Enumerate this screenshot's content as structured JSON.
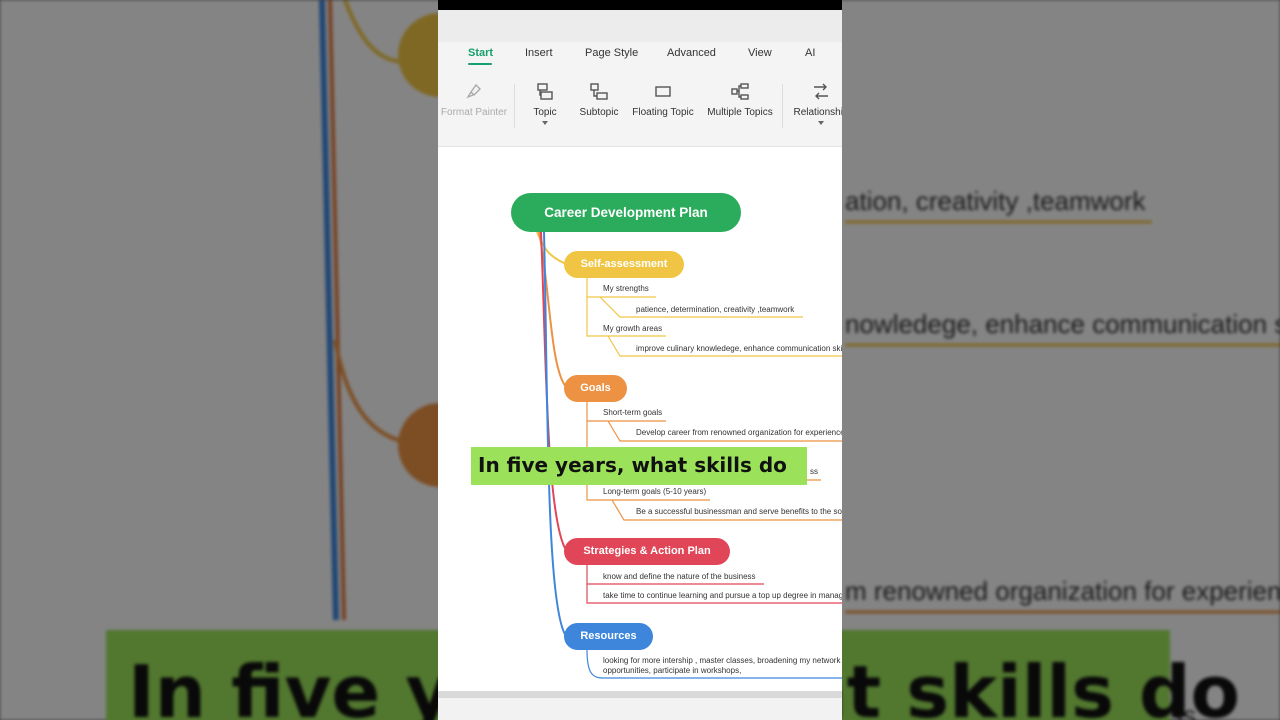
{
  "menu": {
    "tabs": [
      "Start",
      "Insert",
      "Page Style",
      "Advanced",
      "View",
      "AI"
    ],
    "active_tab": "Start"
  },
  "toolbar": {
    "format_painter": "Format Painter",
    "topic": "Topic",
    "subtopic": "Subtopic",
    "floating_topic": "Floating Topic",
    "multiple_topics": "Multiple Topics",
    "relationship": "Relationship"
  },
  "mindmap": {
    "root": "Career Development Plan",
    "self_assessment": {
      "title": "Self-assessment",
      "strengths_label": "My strengths",
      "strengths_text": "patience, determination, creativity ,teamwork",
      "growth_label": "My growth areas",
      "growth_text": "improve culinary knowledege, enhance communication skills"
    },
    "goals": {
      "title": "Goals",
      "short_label": "Short-term goals",
      "short_text": "Develop career from renowned organization for experience",
      "hidden_text": "ss",
      "long_label": "Long-term goals (5-10 years)",
      "long_text": "Be a successful businessman and serve benefits to the society"
    },
    "strategies": {
      "title": "Strategies & Action Plan",
      "item1": "know and define the nature of the business",
      "item2": "take time to continue learning and pursue a top up degree in management"
    },
    "resources": {
      "title": "Resources",
      "line1": "looking for more intership , master classes, broadening my network",
      "line2": "opportunities,  participate in workshops,"
    }
  },
  "background": {
    "line1": "ation, creativity ,teamwork",
    "line2": "nowledege, enhance communication ski",
    "line3": "m renowned organization for experience",
    "line4": "ss"
  },
  "caption": "In five years, what skills do",
  "colors": {
    "root": "#2bab5c",
    "self_assessment": "#f0c544",
    "goals": "#ec9242",
    "strategies": "#e04657",
    "resources": "#3e86dc",
    "active_tab": "#16a06b",
    "caption_bg": "#9be25a"
  }
}
